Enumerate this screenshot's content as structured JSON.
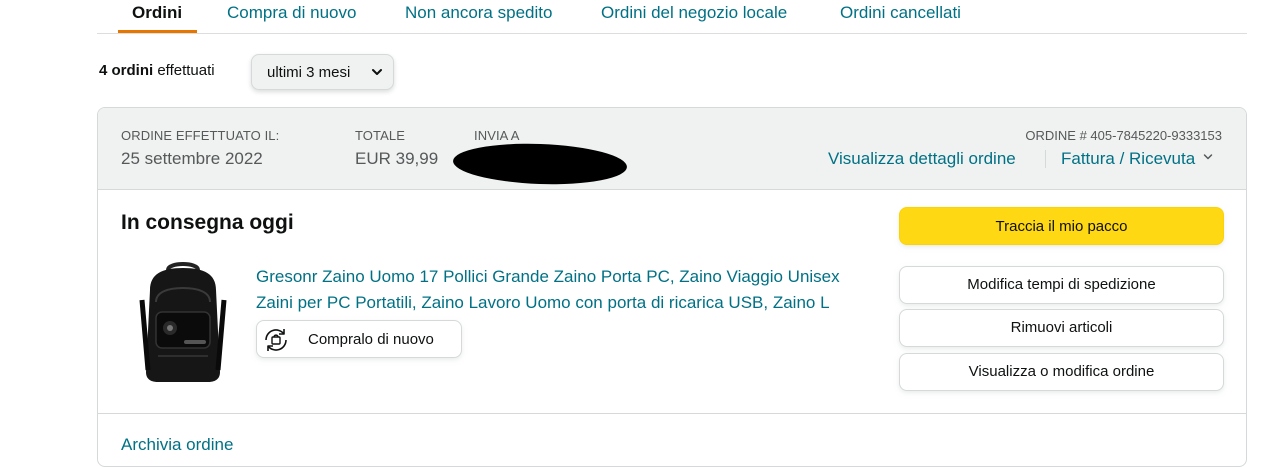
{
  "tabs": [
    {
      "label": "Ordini",
      "active": true
    },
    {
      "label": "Compra di nuovo",
      "active": false
    },
    {
      "label": "Non ancora spedito",
      "active": false
    },
    {
      "label": "Ordini del negozio locale",
      "active": false
    },
    {
      "label": "Ordini cancellati",
      "active": false
    }
  ],
  "summary": {
    "count_bold": "4 ordini",
    "suffix": "effettuati",
    "range_selected": "ultimi 3 mesi"
  },
  "order": {
    "placed_label": "ORDINE EFFETTUATO IL:",
    "placed_value": "25 settembre 2022",
    "total_label": "TOTALE",
    "total_value": "EUR 39,99",
    "ship_to_label": "INVIA A",
    "order_number": "ORDINE # 405-7845220-9333153",
    "details_link": "Visualizza dettagli ordine",
    "invoice_link": "Fattura / Ricevuta",
    "status": "In consegna oggi",
    "product_title": "Gresonr Zaino Uomo 17 Pollici Grande Zaino Porta PC, Zaino Viaggio Unisex Zaini per PC Portatili, Zaino Lavoro Uomo con porta di ricarica USB, Zaino L",
    "buy_again": "Compralo di nuovo",
    "actions": {
      "track": "Traccia il mio pacco",
      "change_delivery": "Modifica tempi di spedizione",
      "remove_items": "Rimuovi articoli",
      "view_edit": "Visualizza o modifica ordine"
    },
    "archive": "Archivia ordine"
  },
  "icons": {
    "range_chevron": "chevron-down-icon",
    "invoice_chevron": "chevron-down-icon",
    "buy_again_icon": "rebuy-icon"
  },
  "colors": {
    "link": "#007185",
    "tab_underline": "#e77600",
    "primary_button": "#ffd814",
    "header_bg": "#f0f2f2"
  }
}
